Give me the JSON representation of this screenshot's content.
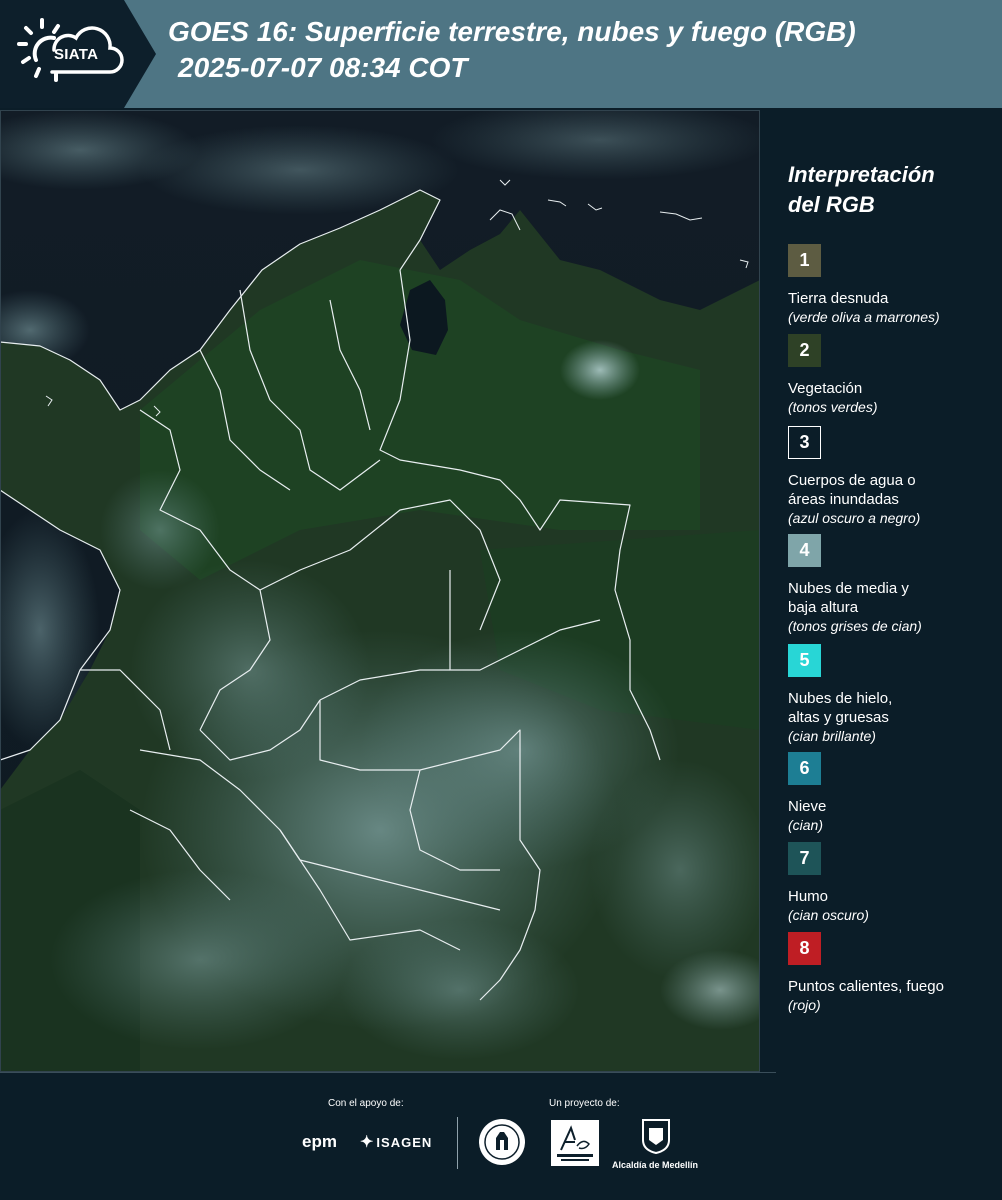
{
  "header": {
    "logo_text": "SIATA",
    "title_line1": "GOES 16: Superficie terrestre, nubes y fuego (RGB)",
    "title_line2": "2025-07-07 08:34 COT",
    "colors": {
      "dark_panel": "#0d1f2b",
      "header_band": "#4e7584"
    }
  },
  "map": {
    "icon": "satellite-rgb-map-image"
  },
  "legend": {
    "title_line1": "Interpretación",
    "title_line2": "del RGB",
    "items": [
      {
        "number": "1",
        "label": "Tierra desnuda",
        "desc": "(verde oliva a marrones)",
        "color": "#5d5c42"
      },
      {
        "number": "2",
        "label": "Vegetación",
        "desc": "(tonos verdes)",
        "color": "#2e4126"
      },
      {
        "number": "3",
        "label": "Cuerpos de agua o áreas inundadas",
        "desc": "(azul oscuro a negro)",
        "color": "#0b1d28"
      },
      {
        "number": "4",
        "label": "Nubes de media y baja altura",
        "desc": "(tonos grises de cian)",
        "color": "#7fa5a9"
      },
      {
        "number": "5",
        "label": "Nubes de hielo, altas y gruesas",
        "desc": "(cian brillante)",
        "color": "#28d6d6"
      },
      {
        "number": "6",
        "label": "Nieve",
        "desc": "(cian)",
        "color": "#1d7e94"
      },
      {
        "number": "7",
        "label": "Humo",
        "desc": "(cian oscuro)",
        "color": "#1e5458"
      },
      {
        "number": "8",
        "label": "Puntos calientes, fuego",
        "desc": "(rojo)",
        "color": "#bf1e24"
      }
    ]
  },
  "footer": {
    "support_label": "Con el apoyo de:",
    "project_label": "Un proyecto de:",
    "epm": "epm",
    "isagen": "ISAGEN",
    "alcaldia": "Alcaldía de Medellín"
  }
}
